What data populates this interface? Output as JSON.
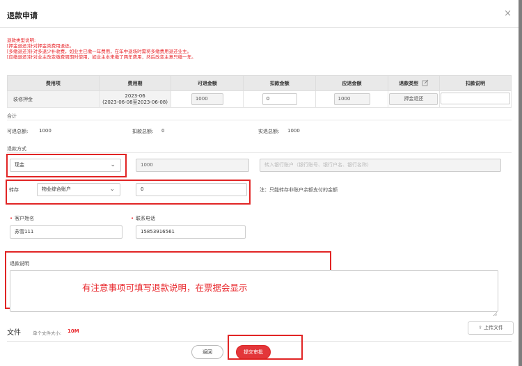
{
  "dialog": {
    "title": "退款申请",
    "close_glyph": "×"
  },
  "notes": [
    "退款类型说明:",
    "[押金退还]针对押金类费用退还。",
    "[多缴退还]针对多退少补收费，如业主已缴一年费用，在年中退场时需将多缴费用退还业主。",
    "[应缴退还]针对业主改变缴费周期时使用，如业主本来缴了两年费用，然后改变主意只缴一年。"
  ],
  "table": {
    "headers": [
      "费用项",
      "费用期",
      "可退金额",
      "扣款金额",
      "应退金额",
      "退款类型",
      "扣款说明"
    ],
    "row": {
      "item": "装修押金",
      "period_main": "2023-06",
      "period_range": "(2023-06-08至2023-06-08)",
      "refundable": "1000",
      "deduction": "0",
      "should_refund": "1000",
      "refund_type": "押金退还",
      "deduction_note": ""
    }
  },
  "totals": {
    "section_label": "合计",
    "refundable_label": "可退总额:",
    "refundable_value": "1000",
    "deduction_label": "扣款总额:",
    "deduction_value": "0",
    "actual_label": "实退总额:",
    "actual_value": "1000"
  },
  "refund_method": {
    "section_label": "退款方式",
    "method_value": "现金",
    "amount_value": "1000",
    "bank_placeholder": "转入银行账户（银行账号、银行户名、银行名称）",
    "transfer_label": "转存",
    "transfer_account": "物业综合账户",
    "transfer_amount": "0",
    "transfer_note": "注：只能转存非账户余额支付的金额"
  },
  "customer": {
    "name_label": "客户姓名",
    "name_value": "苏雪111",
    "phone_label": "联系电话",
    "phone_value": "15853916561",
    "required_mark": "•"
  },
  "explanation": {
    "label": "退款说明",
    "annotation": "有注意事项可填写退款说明，在票据会显示",
    "value": ""
  },
  "files": {
    "label": "文件",
    "size_label": "单个文件大小:",
    "size_value": "10M",
    "upload_label": "上传文件"
  },
  "actions": {
    "back_label": "返回",
    "submit_label": "提交审批"
  },
  "colors": {
    "accent": "#e12424",
    "annotation": "#e8252a",
    "submit": "#e3363a"
  }
}
